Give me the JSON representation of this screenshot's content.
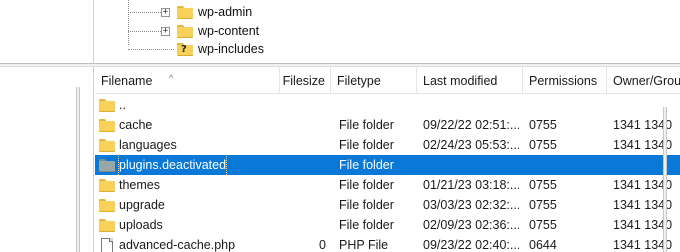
{
  "tree": {
    "nodes": [
      {
        "label": "wp-admin",
        "icon": "folder-icon",
        "expander": "+"
      },
      {
        "label": "wp-content",
        "icon": "folder-icon",
        "expander": "+"
      },
      {
        "label": "wp-includes",
        "icon": "folder-question-icon",
        "expander": ""
      }
    ]
  },
  "list": {
    "sort_indicator": "^",
    "headers": {
      "filename": "Filename",
      "filesize": "Filesize",
      "filetype": "Filetype",
      "modified": "Last modified",
      "permissions": "Permissions",
      "owner": "Owner/Grou"
    },
    "rows": [
      {
        "name": "..",
        "size": "",
        "type": "",
        "modified": "",
        "permissions": "",
        "owner": "",
        "icon": "folder-icon"
      },
      {
        "name": "cache",
        "size": "",
        "type": "File folder",
        "modified": "09/22/22 02:51:...",
        "permissions": "0755",
        "owner": "1341 1340",
        "icon": "folder-icon"
      },
      {
        "name": "languages",
        "size": "",
        "type": "File folder",
        "modified": "02/24/23 05:53:...",
        "permissions": "0755",
        "owner": "1341 1340",
        "icon": "folder-icon"
      },
      {
        "name": "plugins.deactivated",
        "size": "",
        "type": "File folder",
        "modified": "",
        "permissions": "",
        "owner": "",
        "icon": "folder-gray-icon",
        "selected": true
      },
      {
        "name": "themes",
        "size": "",
        "type": "File folder",
        "modified": "01/21/23 03:18:...",
        "permissions": "0755",
        "owner": "1341 1340",
        "icon": "folder-icon"
      },
      {
        "name": "upgrade",
        "size": "",
        "type": "File folder",
        "modified": "03/03/23 02:32:...",
        "permissions": "0755",
        "owner": "1341 1340",
        "icon": "folder-icon"
      },
      {
        "name": "uploads",
        "size": "",
        "type": "File folder",
        "modified": "02/09/23 02:36:...",
        "permissions": "0755",
        "owner": "1341 1340",
        "icon": "folder-icon"
      },
      {
        "name": "advanced-cache.php",
        "size": "0",
        "type": "PHP File",
        "modified": "09/23/22 02:40:...",
        "permissions": "0644",
        "owner": "1341 1340",
        "icon": "file-icon"
      }
    ]
  },
  "colors": {
    "selection": "#0a78d7",
    "folder": "#f7d15a",
    "folder_gray": "#98a6a6"
  }
}
